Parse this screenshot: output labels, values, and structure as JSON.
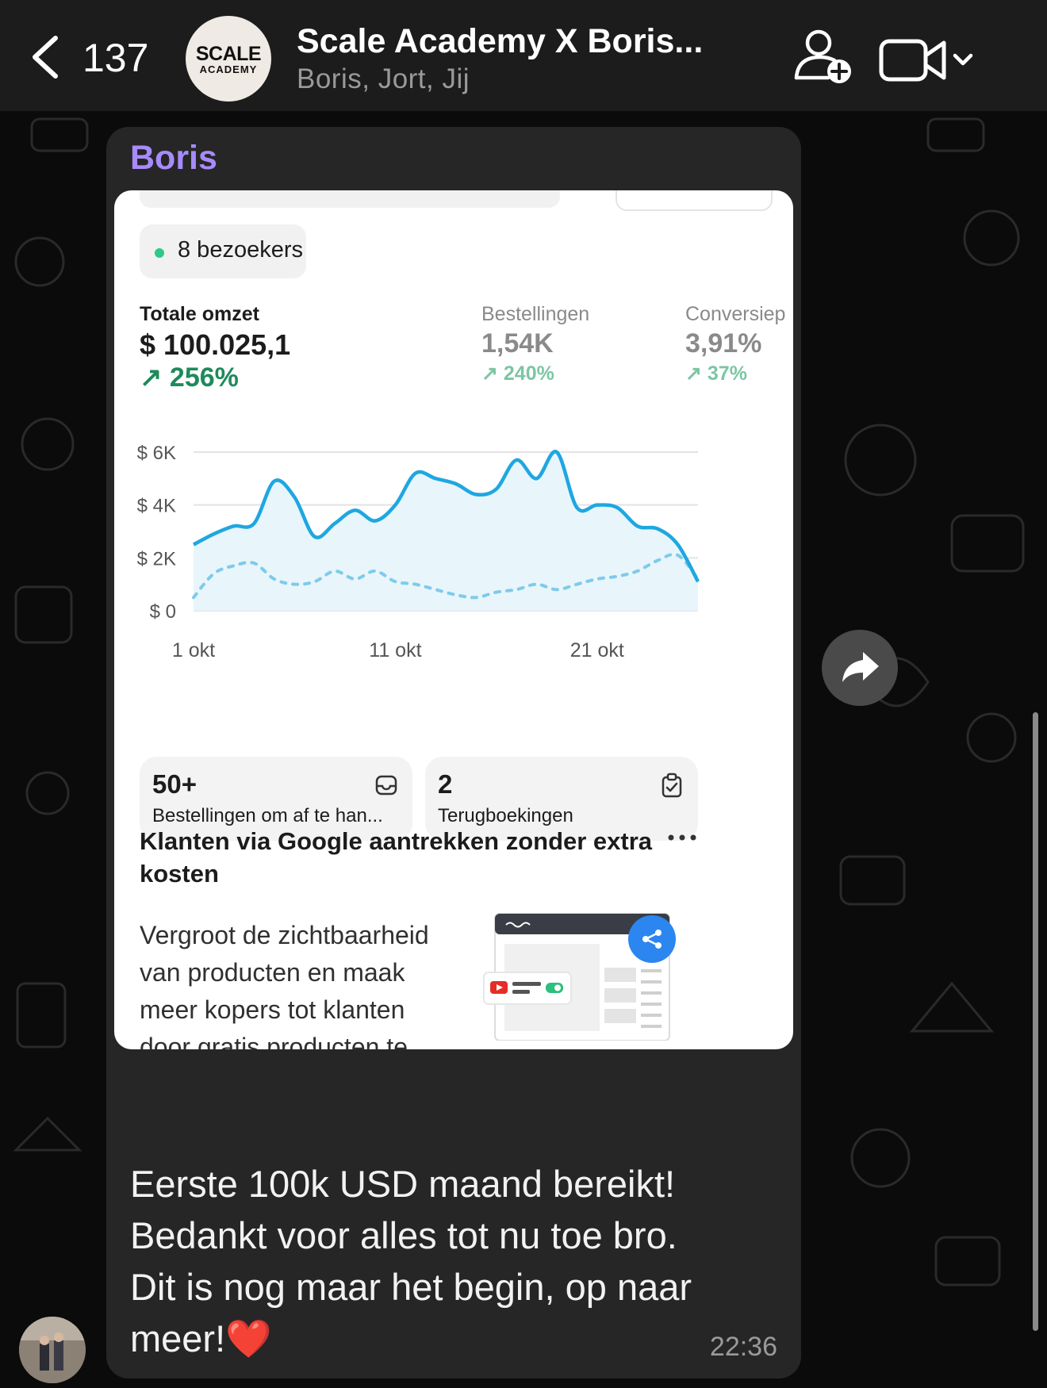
{
  "header": {
    "unread_count": "137",
    "group_logo_top": "SCALE",
    "group_logo_bottom": "ACADEMY",
    "title": "Scale Academy X Boris...",
    "participants": "Boris, Jort, Jij"
  },
  "message": {
    "sender": "Boris",
    "text_lines": [
      "Eerste 100k USD maand bereikt!",
      "Bedankt voor alles tot nu toe bro.",
      "Dit is nog maar het begin, op naar",
      "meer!"
    ],
    "heart": "❤️",
    "time": "22:36"
  },
  "dashboard": {
    "visitors": "8 bezoekers",
    "metrics": [
      {
        "label": "Totale omzet",
        "value": "$ 100.025,1",
        "change": "↗ 256%"
      },
      {
        "label": "Bestellingen",
        "value": "1,54K",
        "change": "↗ 240%"
      },
      {
        "label": "Conversiep",
        "value": "3,91%",
        "change": "↗ 37%"
      }
    ],
    "cards": [
      {
        "value": "50+",
        "label": "Bestellingen om af te han...",
        "icon": "inbox-icon"
      },
      {
        "value": "2",
        "label": "Terugboekingen",
        "icon": "clipboard-check-icon"
      }
    ],
    "promo": {
      "title": "Klanten via Google aantrekken zonder extra kosten",
      "body_lines": [
        "Vergroot de zichtbaarheid",
        "van producten en maak",
        "meer kopers tot klanten",
        "door gratis producten te"
      ]
    }
  },
  "chart_data": {
    "type": "line",
    "x_tick_labels": [
      "1 okt",
      "11 okt",
      "21 okt"
    ],
    "y_tick_labels": [
      "$ 0",
      "$ 2K",
      "$ 4K",
      "$ 6K"
    ],
    "ylim": [
      0,
      6000
    ],
    "x": [
      1,
      2,
      3,
      4,
      5,
      6,
      7,
      8,
      9,
      10,
      11,
      12,
      13,
      14,
      15,
      16,
      17,
      18,
      19,
      20,
      21,
      22,
      23,
      24,
      25,
      26
    ],
    "series": [
      {
        "style": "solid",
        "values": [
          2500,
          2900,
          3200,
          3300,
          4900,
          4300,
          2800,
          3300,
          3800,
          3400,
          4000,
          5200,
          5000,
          4800,
          4400,
          4600,
          5700,
          5000,
          6000,
          3900,
          4000,
          3900,
          3200,
          3100,
          2500,
          1100
        ]
      },
      {
        "style": "dashed",
        "values": [
          500,
          1400,
          1700,
          1800,
          1200,
          1000,
          1100,
          1500,
          1200,
          1500,
          1100,
          1000,
          800,
          600,
          500,
          700,
          800,
          1000,
          800,
          1000,
          1200,
          1300,
          1500,
          1900,
          2100,
          1200
        ]
      }
    ],
    "grid": true,
    "colors": {
      "solid": "#1ea7e1",
      "dashed": "#7ecbea",
      "fill": "#e8f5fb"
    }
  },
  "colors": {
    "sender_name": "#a78bfa",
    "positive_change": "#1f8a5c",
    "bubble": "#262626"
  }
}
